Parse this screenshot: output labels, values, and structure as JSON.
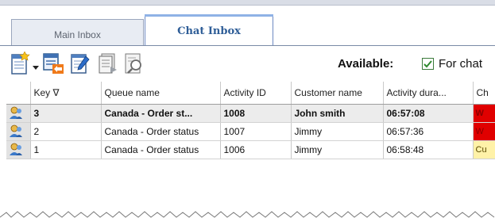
{
  "tabs": [
    {
      "label": "Main Inbox",
      "active": false
    },
    {
      "label": "Chat Inbox",
      "active": true
    }
  ],
  "toolbar": {
    "icons": [
      "new-item-icon",
      "dropdown-arrow-icon",
      "accept-chat-icon",
      "edit-note-icon",
      "document-list-icon",
      "search-document-icon"
    ],
    "available_label": "Available:",
    "available_checked": true,
    "available_for_label": "For chat"
  },
  "table": {
    "headers": [
      "",
      "Key ∇",
      "Queue name",
      "Activity ID",
      "Customer name",
      "Activity dura...",
      "Ch"
    ],
    "rows": [
      {
        "key": "3",
        "queue": "Canada - Order st...",
        "activity_id": "1008",
        "customer": "John smith",
        "duration": "06:57:08",
        "status": "W",
        "status_color": "#e00000",
        "bold": true
      },
      {
        "key": "2",
        "queue": "Canada - Order status",
        "activity_id": "1007",
        "customer": "Jimmy",
        "duration": "06:57:36",
        "status": "W",
        "status_color": "#e00000",
        "bold": false
      },
      {
        "key": "1",
        "queue": "Canada - Order status",
        "activity_id": "1006",
        "customer": "Jimmy",
        "duration": "06:58:48",
        "status": "Cu",
        "status_color": "#fff2a8",
        "bold": false
      }
    ]
  },
  "colors": {
    "accent": "#2e5d97",
    "row_selected": "#ececec"
  }
}
